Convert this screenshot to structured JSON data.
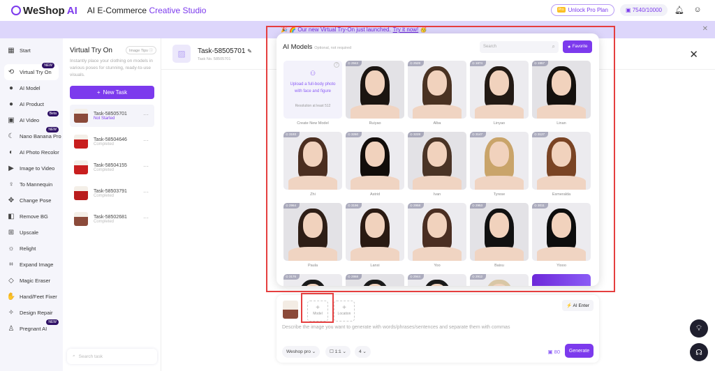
{
  "header": {
    "brand": "WeShop",
    "brand_ai": "AI",
    "title_prefix": "AI E-Commerce",
    "title_accent": "Creative Studio",
    "pro_tag": "Pro",
    "unlock": "Unlock Pro Plan",
    "credits": "7540/10000"
  },
  "banner": {
    "text": "🎉 🌈 Our new Virtual Try-On just launched.",
    "link": "Try it now!",
    "emoji": "🥳"
  },
  "sidebar": {
    "items": [
      {
        "label": "Start",
        "icon": "▦"
      },
      {
        "label": "Virtual Try On",
        "icon": "⟲",
        "badge": "NEW"
      },
      {
        "label": "AI Model",
        "icon": "●"
      },
      {
        "label": "AI Product",
        "icon": "●"
      },
      {
        "label": "AI Video",
        "icon": "▣",
        "badge": "Beta"
      },
      {
        "label": "Nano Banana Pro",
        "icon": "☾",
        "badge": "NEW"
      },
      {
        "label": "AI Photo Recolor",
        "icon": "◐"
      },
      {
        "label": "Image to Video",
        "icon": "▶"
      },
      {
        "label": "To Mannequin",
        "icon": "♀"
      },
      {
        "label": "Change Pose",
        "icon": "✥"
      },
      {
        "label": "Remove BG",
        "icon": "◧"
      },
      {
        "label": "Upscale",
        "icon": "⊞"
      },
      {
        "label": "Relight",
        "icon": "☼"
      },
      {
        "label": "Expand Image",
        "icon": "⌗"
      },
      {
        "label": "Magic Eraser",
        "icon": "◇"
      },
      {
        "label": "Hand/Feet Fixer",
        "icon": "✋"
      },
      {
        "label": "Design Repair",
        "icon": "✧"
      },
      {
        "label": "Pregnant AI",
        "icon": "♙",
        "badge": "NEW"
      }
    ]
  },
  "tasks_panel": {
    "title": "Virtual Try On",
    "tips": "Image Tips ⓘ",
    "desc": "Instantly place your clothing on models in various poses for stunning, ready-to-use visuals.",
    "new_task": "New Task",
    "search_placeholder": "Search task",
    "tasks": [
      {
        "name": "Task-58505701",
        "status": "Not Started",
        "color": "#8b4a3a"
      },
      {
        "name": "Task-58504646",
        "status": "Completed",
        "color": "#c81e1e"
      },
      {
        "name": "Task-58504155",
        "status": "Completed",
        "color": "#c81e1e"
      },
      {
        "name": "Task-58503791",
        "status": "Completed",
        "color": "#b91c1c"
      },
      {
        "name": "Task-58502681",
        "status": "Completed",
        "color": "#8b4a3a"
      }
    ]
  },
  "main": {
    "task_title": "Task-58505701",
    "task_no": "Task No. 58505701"
  },
  "models_modal": {
    "title": "AI Models",
    "subtitle": "Optional, not required",
    "search_placeholder": "Search",
    "favorite": "Favorite",
    "create": {
      "text": "Upload a full-body photo with face and figure",
      "resolution": "Resolution at least 512",
      "label": "Create New Model"
    },
    "models": [
      {
        "name": "Ruiyao",
        "count": "2942",
        "hair": "#1b1511"
      },
      {
        "name": "Alba",
        "count": "2528",
        "hair": "#4a3222"
      },
      {
        "name": "Linyao",
        "count": "1874",
        "hair": "#231a14"
      },
      {
        "name": "Linan",
        "count": "1957",
        "hair": "#15110e"
      },
      {
        "name": "Zhi",
        "count": "3193",
        "hair": "#4b2e20"
      },
      {
        "name": "Astrid",
        "count": "3260",
        "hair": "#120d0a"
      },
      {
        "name": "Ivan",
        "count": "3228",
        "hair": "#4a3426"
      },
      {
        "name": "Tyrese",
        "count": "3147",
        "hair": "#c9a46a"
      },
      {
        "name": "Esmeralda",
        "count": "3127",
        "hair": "#7a4424"
      },
      {
        "name": "Paula",
        "count": "2964",
        "hair": "#2e1e16"
      },
      {
        "name": "Lanxi",
        "count": "3196",
        "hair": "#2a1a12"
      },
      {
        "name": "Yoo",
        "count": "2958",
        "hair": "#4a2e22"
      },
      {
        "name": "Baixu",
        "count": "2953",
        "hair": "#111"
      },
      {
        "name": "Yiooo",
        "count": "3011",
        "hair": "#0d0d0d"
      },
      {
        "name": "",
        "count": "3176",
        "hair": "#1a1a1a"
      },
      {
        "name": "",
        "count": "2868",
        "hair": "#1a1a1a"
      },
      {
        "name": "",
        "count": "2944",
        "hair": "#1a1a1a"
      },
      {
        "name": "",
        "count": "2912",
        "hair": "#d9c7a6"
      }
    ]
  },
  "prompt": {
    "slot_model": "Model",
    "slot_location": "Location",
    "ai_enter": "AI Enter",
    "placeholder": "Describe the image you want to generate with words/phrases/sentences and separate them with commas",
    "engine": "Weshop pro ⌄",
    "ratio": "1:1 ⌄",
    "count": "4 ⌄",
    "cost": "80",
    "generate": "Generate"
  }
}
